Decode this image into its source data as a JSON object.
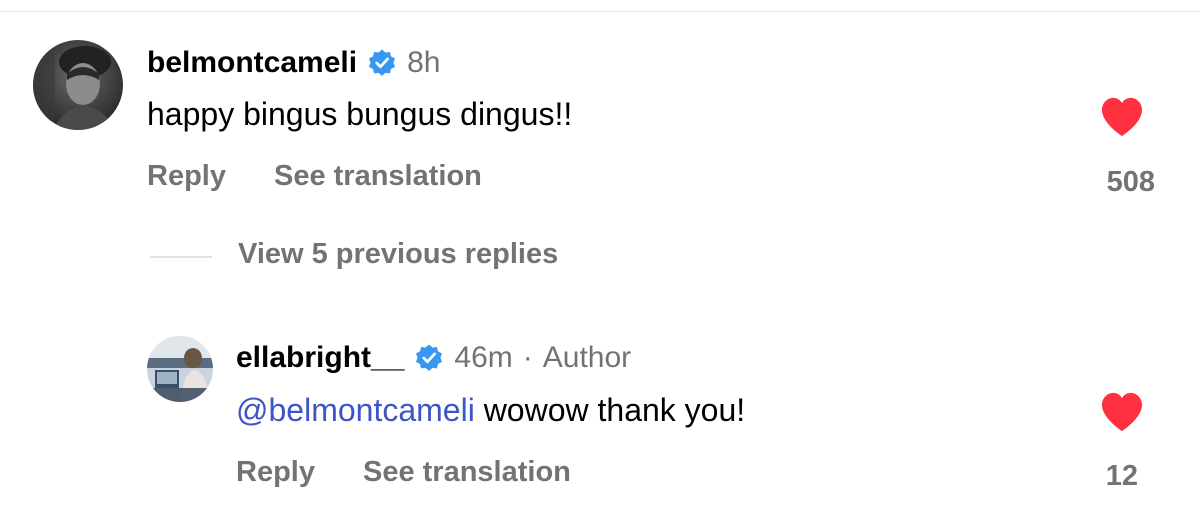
{
  "comment": {
    "username": "belmontcameli",
    "time": "8h",
    "text": "happy bingus bungus dingus!!",
    "reply_label": "Reply",
    "translation_label": "See translation",
    "like_count": "508"
  },
  "view_replies_label": "View 5 previous replies",
  "reply": {
    "username": "ellabright__",
    "time": "46m",
    "separator": "·",
    "badge": "Author",
    "mention": "@belmontcameli",
    "text": " wowow thank you!",
    "reply_label": "Reply",
    "translation_label": "See translation",
    "like_count": "12"
  },
  "colors": {
    "verified": "#3897f0",
    "heart": "#ff3040",
    "mention": "#3d55c7",
    "secondary_text": "#737373"
  },
  "icons": {
    "verified": "verified-badge-icon",
    "like": "heart-icon"
  }
}
